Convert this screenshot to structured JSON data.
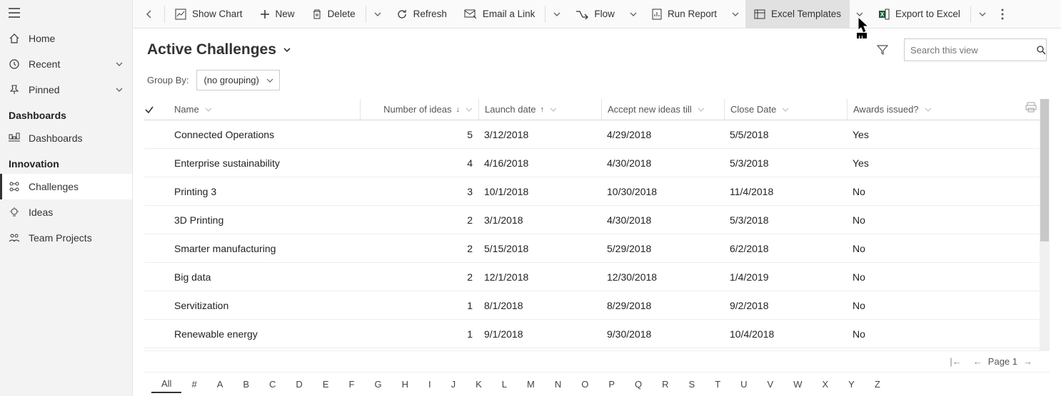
{
  "sidebar": {
    "home": "Home",
    "recent": "Recent",
    "pinned": "Pinned",
    "section_dashboards": "Dashboards",
    "dashboards": "Dashboards",
    "section_innovation": "Innovation",
    "challenges": "Challenges",
    "ideas": "Ideas",
    "team_projects": "Team Projects"
  },
  "toolbar": {
    "show_chart": "Show Chart",
    "new": "New",
    "delete": "Delete",
    "refresh": "Refresh",
    "email_link": "Email a Link",
    "flow": "Flow",
    "run_report": "Run Report",
    "excel_templates": "Excel Templates",
    "export_excel": "Export to Excel"
  },
  "view": {
    "title": "Active Challenges",
    "groupby_label": "Group By:",
    "groupby_value": "(no grouping)",
    "search_placeholder": "Search this view"
  },
  "columns": {
    "name": "Name",
    "num_ideas": "Number of ideas",
    "launch": "Launch date",
    "accept": "Accept new ideas till",
    "close": "Close Date",
    "awards": "Awards issued?"
  },
  "rows": [
    {
      "name": "Connected Operations",
      "num": "5",
      "launch": "3/12/2018",
      "accept": "4/29/2018",
      "close": "5/5/2018",
      "awards": "Yes"
    },
    {
      "name": "Enterprise sustainability",
      "num": "4",
      "launch": "4/16/2018",
      "accept": "4/30/2018",
      "close": "5/3/2018",
      "awards": "Yes"
    },
    {
      "name": "Printing 3",
      "num": "3",
      "launch": "10/1/2018",
      "accept": "10/30/2018",
      "close": "11/4/2018",
      "awards": "No"
    },
    {
      "name": "3D Printing",
      "num": "2",
      "launch": "3/1/2018",
      "accept": "4/30/2018",
      "close": "5/3/2018",
      "awards": "No"
    },
    {
      "name": "Smarter manufacturing",
      "num": "2",
      "launch": "5/15/2018",
      "accept": "5/29/2018",
      "close": "6/2/2018",
      "awards": "No"
    },
    {
      "name": "Big data",
      "num": "2",
      "launch": "12/1/2018",
      "accept": "12/30/2018",
      "close": "1/4/2019",
      "awards": "No"
    },
    {
      "name": "Servitization",
      "num": "1",
      "launch": "8/1/2018",
      "accept": "8/29/2018",
      "close": "9/2/2018",
      "awards": "No"
    },
    {
      "name": "Renewable energy",
      "num": "1",
      "launch": "9/1/2018",
      "accept": "9/30/2018",
      "close": "10/4/2018",
      "awards": "No"
    }
  ],
  "pager": {
    "page": "Page 1"
  },
  "alpha": [
    "All",
    "#",
    "A",
    "B",
    "C",
    "D",
    "E",
    "F",
    "G",
    "H",
    "I",
    "J",
    "K",
    "L",
    "M",
    "N",
    "O",
    "P",
    "Q",
    "R",
    "S",
    "T",
    "U",
    "V",
    "W",
    "X",
    "Y",
    "Z"
  ]
}
